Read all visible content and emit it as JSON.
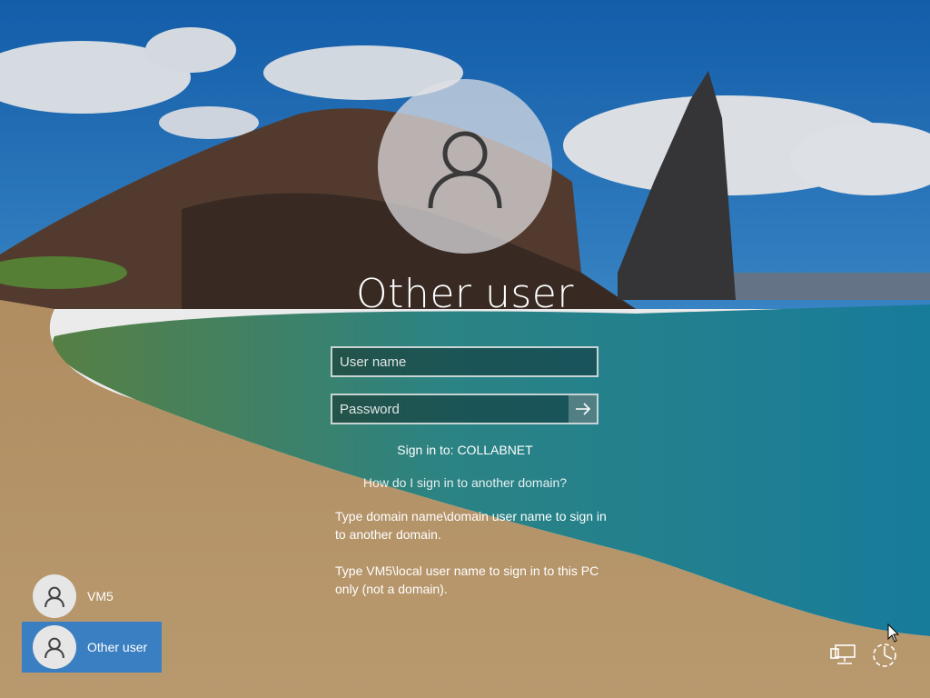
{
  "login": {
    "title": "Other user",
    "username_placeholder": "User name",
    "password_placeholder": "Password",
    "sign_in_to": "Sign in to: COLLABNET",
    "help_link": "How do I sign in to another domain?",
    "help_text_1": "Type domain name\\domain user name to sign in to another domain.",
    "help_text_2": "Type VM5\\local user name to sign in to this PC only (not a domain)."
  },
  "users": [
    {
      "label": "VM5",
      "selected": false
    },
    {
      "label": "Other user",
      "selected": true
    }
  ],
  "icons": {
    "avatar": "user-icon",
    "submit": "arrow-right-icon",
    "network": "network-icon",
    "accessibility": "ease-of-access-icon",
    "cursor": "mouse-cursor-icon"
  },
  "colors": {
    "selected_tile": "#3a7fc1"
  }
}
